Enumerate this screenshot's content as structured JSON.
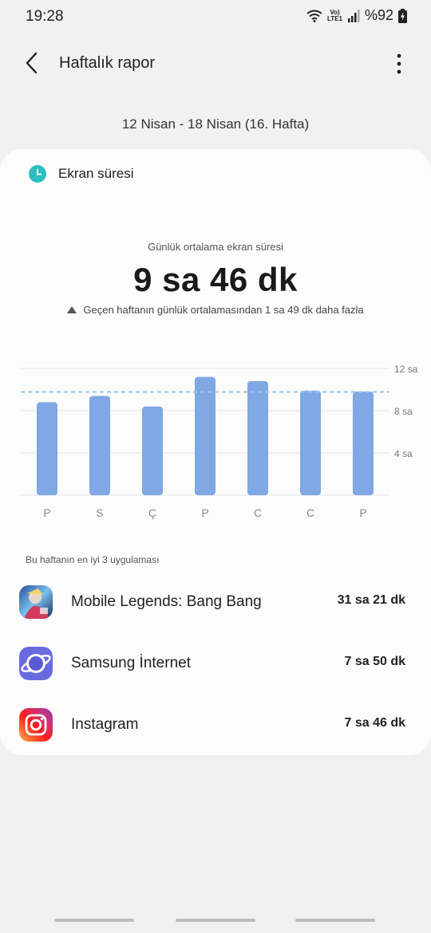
{
  "status": {
    "time": "19:28",
    "battery": "%92",
    "network": "LTE1"
  },
  "header": {
    "title": "Haftalık rapor"
  },
  "date_range": "12 Nisan - 18 Nisan (16. Hafta)",
  "card": {
    "title": "Ekran süresi",
    "avg_label": "Günlük ortalama ekran süresi",
    "avg_value": "9 sa 46 dk",
    "compare_text": "Geçen haftanın günlük ortalamasından 1 sa 49 dk daha fazla"
  },
  "chart_data": {
    "type": "bar",
    "categories": [
      "P",
      "S",
      "Ç",
      "P",
      "C",
      "C",
      "P"
    ],
    "values": [
      8.8,
      9.4,
      8.4,
      11.2,
      10.8,
      9.9,
      9.8
    ],
    "ylim": [
      0,
      12
    ],
    "yticks": [
      4,
      8,
      12
    ],
    "ytick_labels": [
      "4 sa",
      "8 sa",
      "12 sa"
    ],
    "average_line": 9.77,
    "bar_color": "#7fa8e4",
    "avg_line_color": "#9cc3ea",
    "grid": true
  },
  "top_apps": {
    "label": "Bu haftanın en iyi 3 uygulaması",
    "items": [
      {
        "name": "Mobile Legends: Bang Bang",
        "time": "31 sa 21 dk",
        "icon": "mobile-legends-icon"
      },
      {
        "name": "Samsung İnternet",
        "time": "7 sa 50 dk",
        "icon": "samsung-internet-icon"
      },
      {
        "name": "Instagram",
        "time": "7 sa 46 dk",
        "icon": "instagram-icon"
      }
    ]
  }
}
